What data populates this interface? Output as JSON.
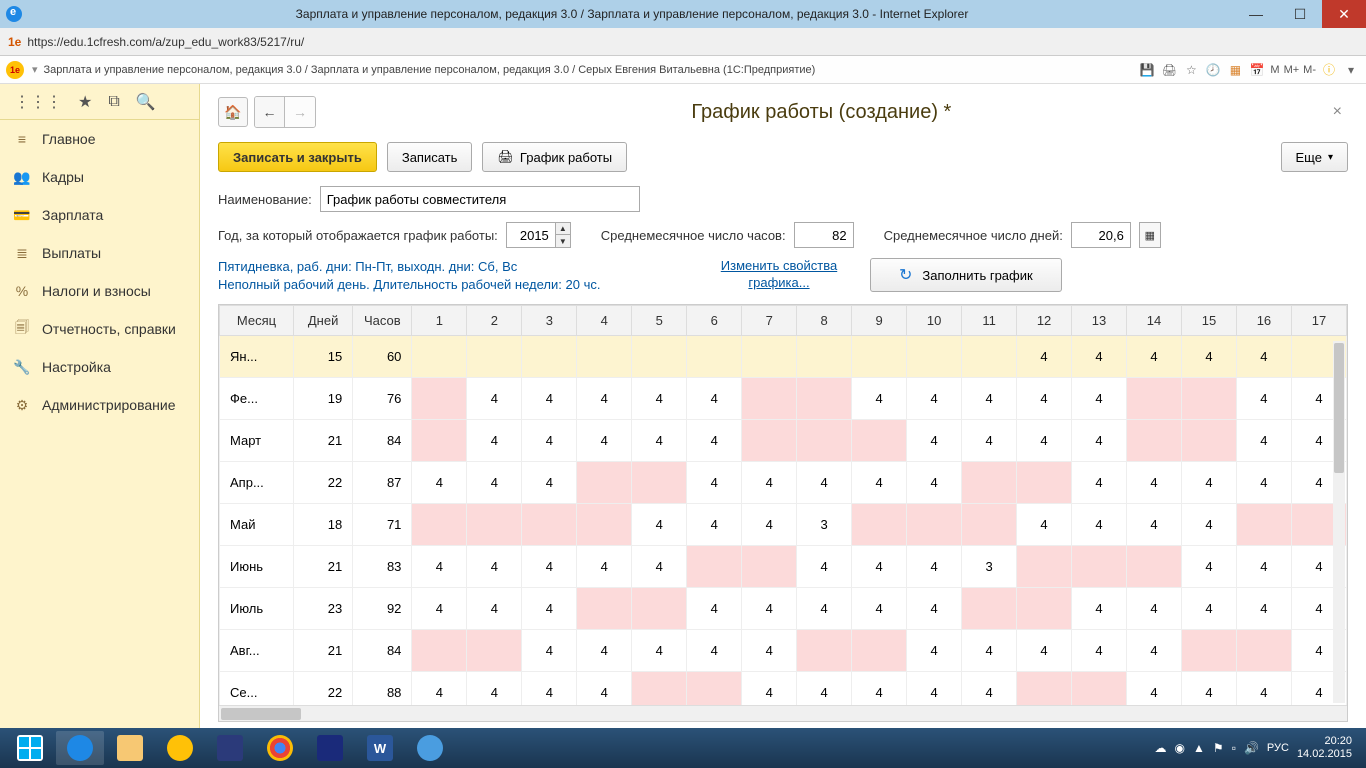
{
  "window": {
    "title": "Зарплата и управление персоналом, редакция 3.0 / Зарплата и управление персоналом, редакция 3.0 - Internet Explorer"
  },
  "browser": {
    "url": "https://edu.1cfresh.com/a/zup_edu_work83/5217/ru/"
  },
  "app_header": {
    "title": "Зарплата и управление персоналом, редакция 3.0 / Зарплата и управление персоналом, редакция 3.0 / Серых Евгения Витальевна  (1С:Предприятие)",
    "m_labels": [
      "M",
      "M+",
      "M-"
    ]
  },
  "sidebar": {
    "items": [
      {
        "icon": "≡",
        "label": "Главное"
      },
      {
        "icon": "👥",
        "label": "Кадры"
      },
      {
        "icon": "💳",
        "label": "Зарплата"
      },
      {
        "icon": "≣",
        "label": "Выплаты"
      },
      {
        "icon": "%",
        "label": "Налоги и взносы"
      },
      {
        "icon": "🗐",
        "label": "Отчетность, справки"
      },
      {
        "icon": "🔧",
        "label": "Настройка"
      },
      {
        "icon": "⚙",
        "label": "Администрирование"
      }
    ]
  },
  "page": {
    "title": "График работы (создание) *",
    "save_close": "Записать и закрыть",
    "save": "Записать",
    "print_schedule": "График работы",
    "more": "Еще",
    "name_label": "Наименование:",
    "name_value": "График работы совместителя",
    "year_label": "Год, за который отображается график работы:",
    "year_value": "2015",
    "avg_hours_label": "Среднемесячное число часов:",
    "avg_hours_value": "82",
    "avg_days_label": "Среднемесячное число дней:",
    "avg_days_value": "20,6",
    "info_line1": "Пятидневка, раб. дни: Пн-Пт, выходн. дни: Сб, Вс",
    "info_line2": "Неполный рабочий день. Длительность рабочей недели: 20 чс.",
    "change_link": "Изменить свойства графика...",
    "fill_btn": "Заполнить график"
  },
  "table": {
    "headers": [
      "Месяц",
      "Дней",
      "Часов",
      "1",
      "2",
      "3",
      "4",
      "5",
      "6",
      "7",
      "8",
      "9",
      "10",
      "11",
      "12",
      "13",
      "14",
      "15",
      "16",
      "17"
    ],
    "rows": [
      {
        "month": "Ян...",
        "days": 15,
        "hours": 60,
        "hl": true,
        "cells": [
          {
            "v": "",
            "w": false
          },
          {
            "v": "",
            "w": false
          },
          {
            "v": "",
            "w": false
          },
          {
            "v": "",
            "w": false
          },
          {
            "v": "",
            "w": false
          },
          {
            "v": "",
            "w": false
          },
          {
            "v": "",
            "w": false
          },
          {
            "v": "",
            "w": false
          },
          {
            "v": "",
            "w": false
          },
          {
            "v": "",
            "w": false
          },
          {
            "v": "",
            "w": false
          },
          {
            "v": "4",
            "w": false
          },
          {
            "v": "4",
            "w": false
          },
          {
            "v": "4",
            "w": false
          },
          {
            "v": "4",
            "w": false
          },
          {
            "v": "4",
            "w": false
          },
          {
            "v": "",
            "w": false
          }
        ]
      },
      {
        "month": "Фе...",
        "days": 19,
        "hours": 76,
        "cells": [
          {
            "v": "",
            "w": true
          },
          {
            "v": "4",
            "w": false
          },
          {
            "v": "4",
            "w": false
          },
          {
            "v": "4",
            "w": false
          },
          {
            "v": "4",
            "w": false
          },
          {
            "v": "4",
            "w": false
          },
          {
            "v": "",
            "w": true
          },
          {
            "v": "",
            "w": true
          },
          {
            "v": "4",
            "w": false
          },
          {
            "v": "4",
            "w": false
          },
          {
            "v": "4",
            "w": false
          },
          {
            "v": "4",
            "w": false
          },
          {
            "v": "4",
            "w": false
          },
          {
            "v": "",
            "w": true
          },
          {
            "v": "",
            "w": true
          },
          {
            "v": "4",
            "w": false
          },
          {
            "v": "4",
            "w": false
          }
        ]
      },
      {
        "month": "Март",
        "days": 21,
        "hours": 84,
        "cells": [
          {
            "v": "",
            "w": true
          },
          {
            "v": "4",
            "w": false
          },
          {
            "v": "4",
            "w": false
          },
          {
            "v": "4",
            "w": false
          },
          {
            "v": "4",
            "w": false
          },
          {
            "v": "4",
            "w": false
          },
          {
            "v": "",
            "w": true
          },
          {
            "v": "",
            "w": true
          },
          {
            "v": "",
            "w": true
          },
          {
            "v": "4",
            "w": false
          },
          {
            "v": "4",
            "w": false
          },
          {
            "v": "4",
            "w": false
          },
          {
            "v": "4",
            "w": false
          },
          {
            "v": "",
            "w": true
          },
          {
            "v": "",
            "w": true
          },
          {
            "v": "4",
            "w": false
          },
          {
            "v": "4",
            "w": false
          }
        ]
      },
      {
        "month": "Апр...",
        "days": 22,
        "hours": 87,
        "cells": [
          {
            "v": "4",
            "w": false
          },
          {
            "v": "4",
            "w": false
          },
          {
            "v": "4",
            "w": false
          },
          {
            "v": "",
            "w": true
          },
          {
            "v": "",
            "w": true
          },
          {
            "v": "4",
            "w": false
          },
          {
            "v": "4",
            "w": false
          },
          {
            "v": "4",
            "w": false
          },
          {
            "v": "4",
            "w": false
          },
          {
            "v": "4",
            "w": false
          },
          {
            "v": "",
            "w": true
          },
          {
            "v": "",
            "w": true
          },
          {
            "v": "4",
            "w": false
          },
          {
            "v": "4",
            "w": false
          },
          {
            "v": "4",
            "w": false
          },
          {
            "v": "4",
            "w": false
          },
          {
            "v": "4",
            "w": false
          }
        ]
      },
      {
        "month": "Май",
        "days": 18,
        "hours": 71,
        "cells": [
          {
            "v": "",
            "w": true
          },
          {
            "v": "",
            "w": true
          },
          {
            "v": "",
            "w": true
          },
          {
            "v": "",
            "w": true
          },
          {
            "v": "4",
            "w": false
          },
          {
            "v": "4",
            "w": false
          },
          {
            "v": "4",
            "w": false
          },
          {
            "v": "3",
            "w": false
          },
          {
            "v": "",
            "w": true
          },
          {
            "v": "",
            "w": true
          },
          {
            "v": "",
            "w": true
          },
          {
            "v": "4",
            "w": false
          },
          {
            "v": "4",
            "w": false
          },
          {
            "v": "4",
            "w": false
          },
          {
            "v": "4",
            "w": false
          },
          {
            "v": "",
            "w": true
          },
          {
            "v": "",
            "w": true
          }
        ]
      },
      {
        "month": "Июнь",
        "days": 21,
        "hours": 83,
        "cells": [
          {
            "v": "4",
            "w": false
          },
          {
            "v": "4",
            "w": false
          },
          {
            "v": "4",
            "w": false
          },
          {
            "v": "4",
            "w": false
          },
          {
            "v": "4",
            "w": false
          },
          {
            "v": "",
            "w": true
          },
          {
            "v": "",
            "w": true
          },
          {
            "v": "4",
            "w": false
          },
          {
            "v": "4",
            "w": false
          },
          {
            "v": "4",
            "w": false
          },
          {
            "v": "3",
            "w": false
          },
          {
            "v": "",
            "w": true
          },
          {
            "v": "",
            "w": true
          },
          {
            "v": "",
            "w": true
          },
          {
            "v": "4",
            "w": false
          },
          {
            "v": "4",
            "w": false
          },
          {
            "v": "4",
            "w": false
          }
        ]
      },
      {
        "month": "Июль",
        "days": 23,
        "hours": 92,
        "cells": [
          {
            "v": "4",
            "w": false
          },
          {
            "v": "4",
            "w": false
          },
          {
            "v": "4",
            "w": false
          },
          {
            "v": "",
            "w": true
          },
          {
            "v": "",
            "w": true
          },
          {
            "v": "4",
            "w": false
          },
          {
            "v": "4",
            "w": false
          },
          {
            "v": "4",
            "w": false
          },
          {
            "v": "4",
            "w": false
          },
          {
            "v": "4",
            "w": false
          },
          {
            "v": "",
            "w": true
          },
          {
            "v": "",
            "w": true
          },
          {
            "v": "4",
            "w": false
          },
          {
            "v": "4",
            "w": false
          },
          {
            "v": "4",
            "w": false
          },
          {
            "v": "4",
            "w": false
          },
          {
            "v": "4",
            "w": false
          }
        ]
      },
      {
        "month": "Авг...",
        "days": 21,
        "hours": 84,
        "cells": [
          {
            "v": "",
            "w": true
          },
          {
            "v": "",
            "w": true
          },
          {
            "v": "4",
            "w": false
          },
          {
            "v": "4",
            "w": false
          },
          {
            "v": "4",
            "w": false
          },
          {
            "v": "4",
            "w": false
          },
          {
            "v": "4",
            "w": false
          },
          {
            "v": "",
            "w": true
          },
          {
            "v": "",
            "w": true
          },
          {
            "v": "4",
            "w": false
          },
          {
            "v": "4",
            "w": false
          },
          {
            "v": "4",
            "w": false
          },
          {
            "v": "4",
            "w": false
          },
          {
            "v": "4",
            "w": false
          },
          {
            "v": "",
            "w": true
          },
          {
            "v": "",
            "w": true
          },
          {
            "v": "4",
            "w": false
          }
        ]
      },
      {
        "month": "Се...",
        "days": 22,
        "hours": 88,
        "cells": [
          {
            "v": "4",
            "w": false
          },
          {
            "v": "4",
            "w": false
          },
          {
            "v": "4",
            "w": false
          },
          {
            "v": "4",
            "w": false
          },
          {
            "v": "",
            "w": true
          },
          {
            "v": "",
            "w": true
          },
          {
            "v": "4",
            "w": false
          },
          {
            "v": "4",
            "w": false
          },
          {
            "v": "4",
            "w": false
          },
          {
            "v": "4",
            "w": false
          },
          {
            "v": "4",
            "w": false
          },
          {
            "v": "",
            "w": true
          },
          {
            "v": "",
            "w": true
          },
          {
            "v": "4",
            "w": false
          },
          {
            "v": "4",
            "w": false
          },
          {
            "v": "4",
            "w": false
          },
          {
            "v": "4",
            "w": false
          }
        ]
      }
    ]
  },
  "taskbar": {
    "time": "20:20",
    "date": "14.02.2015",
    "lang": "РУС"
  }
}
